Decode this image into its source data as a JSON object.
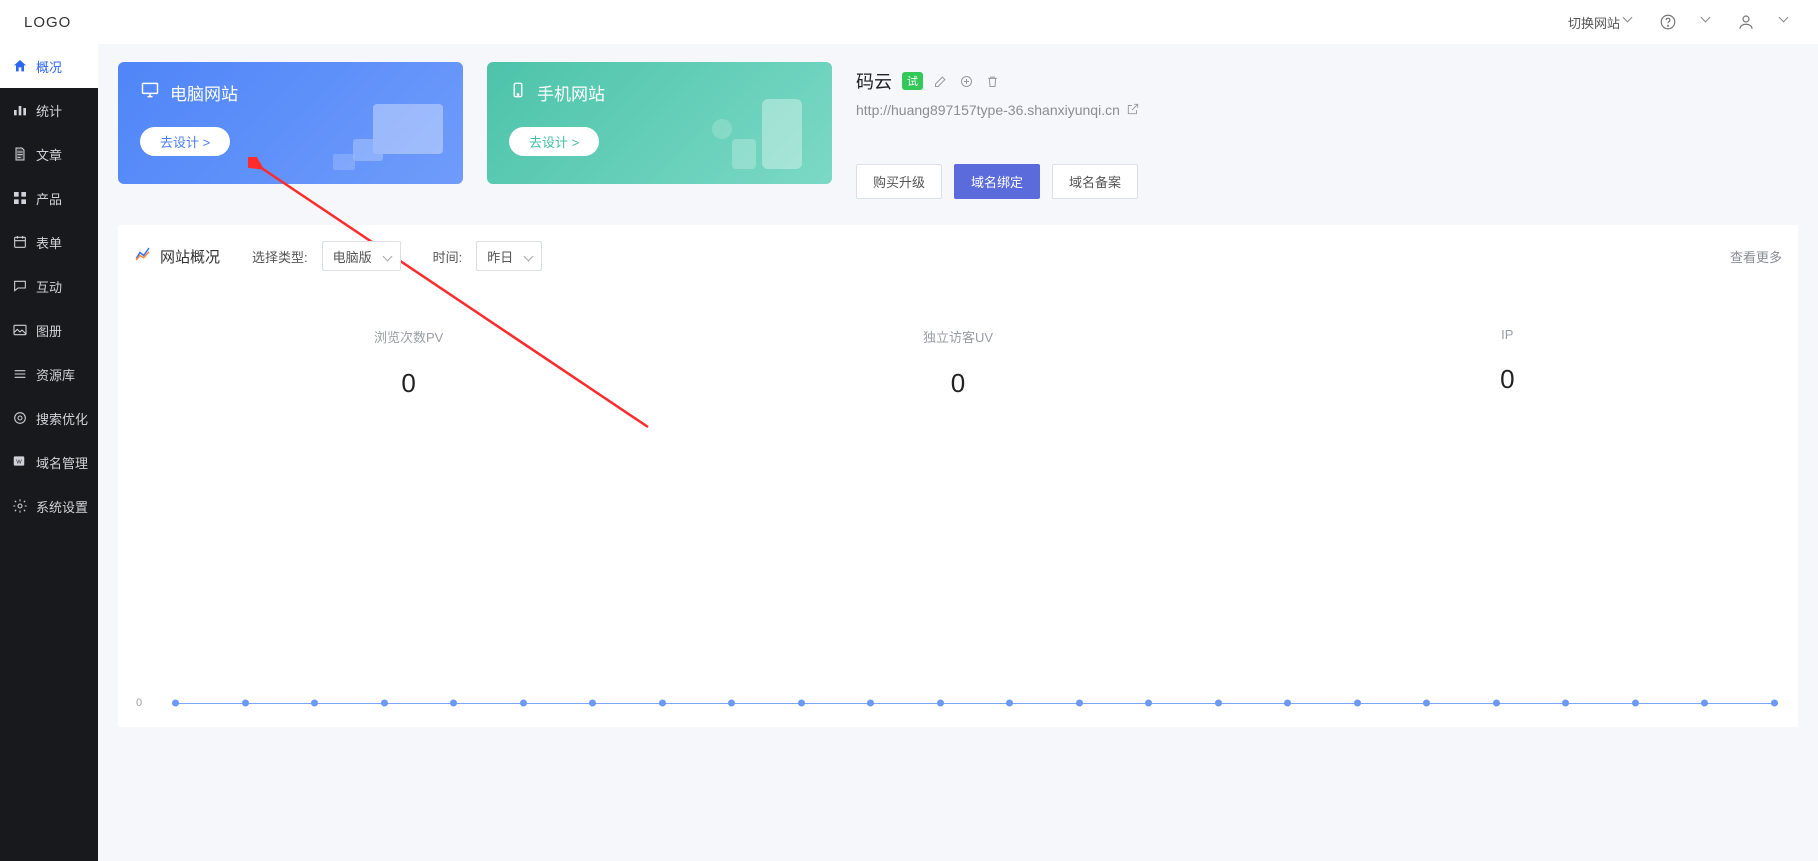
{
  "header": {
    "logo": "LOGO",
    "switchSite": "切换网站"
  },
  "sidebar": {
    "items": [
      {
        "label": "概况"
      },
      {
        "label": "统计"
      },
      {
        "label": "文章"
      },
      {
        "label": "产品"
      },
      {
        "label": "表单"
      },
      {
        "label": "互动"
      },
      {
        "label": "图册"
      },
      {
        "label": "资源库"
      },
      {
        "label": "搜索优化"
      },
      {
        "label": "域名管理"
      },
      {
        "label": "系统设置"
      }
    ]
  },
  "tiles": {
    "pc": {
      "title": "电脑网站",
      "btn": "去设计 >"
    },
    "mobile": {
      "title": "手机网站",
      "btn": "去设计 >"
    }
  },
  "site": {
    "name": "码云",
    "badge": "试",
    "url": "http://huang897157type-36.shanxiyunqi.cn",
    "actions": {
      "buy": "购买升级",
      "bind": "域名绑定",
      "record": "域名备案"
    }
  },
  "panel": {
    "title": "网站概况",
    "typeLabel": "选择类型:",
    "typeValue": "电脑版",
    "timeLabel": "时间:",
    "timeValue": "昨日",
    "more": "查看更多",
    "metrics": [
      {
        "label": "浏览次数PV",
        "value": "0"
      },
      {
        "label": "独立访客UV",
        "value": "0"
      },
      {
        "label": "IP",
        "value": "0"
      }
    ],
    "yAxisZero": "0"
  },
  "chart_data": {
    "type": "line",
    "title": "网站概况",
    "xlabel": "",
    "ylabel": "",
    "ylim": [
      0,
      1
    ],
    "x": [
      0,
      1,
      2,
      3,
      4,
      5,
      6,
      7,
      8,
      9,
      10,
      11,
      12,
      13,
      14,
      15,
      16,
      17,
      18,
      19,
      20,
      21,
      22,
      23
    ],
    "series": [
      {
        "name": "浏览次数PV",
        "values": [
          0,
          0,
          0,
          0,
          0,
          0,
          0,
          0,
          0,
          0,
          0,
          0,
          0,
          0,
          0,
          0,
          0,
          0,
          0,
          0,
          0,
          0,
          0,
          0
        ]
      }
    ]
  }
}
